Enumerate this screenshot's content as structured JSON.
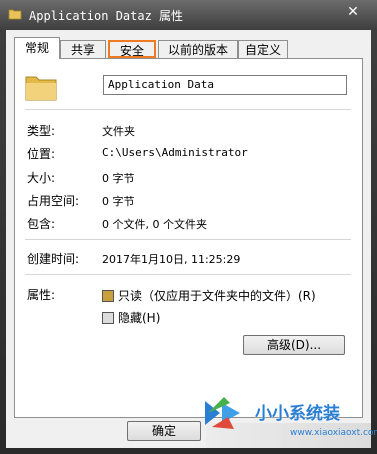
{
  "window": {
    "title": "Application Dataz 属性",
    "close_label": "✕"
  },
  "tabs": [
    {
      "label": "常规"
    },
    {
      "label": "共享"
    },
    {
      "label": "安全"
    },
    {
      "label": "以前的版本"
    },
    {
      "label": "自定义"
    }
  ],
  "general": {
    "name_value": "Application Data",
    "type_label": "类型:",
    "type_value": "文件夹",
    "location_label": "位置:",
    "location_value": "C:\\Users\\Administrator",
    "size_label": "大小:",
    "size_value": "0 字节",
    "disk_label": "占用空间:",
    "disk_value": "0 字节",
    "contains_label": "包含:",
    "contains_value": "0 个文件, 0 个文件夹",
    "created_label": "创建时间:",
    "created_value": "2017年1月10日, 11:25:29",
    "attributes_label": "属性:",
    "readonly_label": "只读（仅应用于文件夹中的文件）(R)",
    "hidden_label": "隐藏(H)",
    "advanced_label": "高级(D)..."
  },
  "buttons": {
    "ok_label": "确定"
  },
  "watermark": {
    "text": "小小系统装",
    "url": "www.xiaoxiaoxt.com"
  },
  "colors": {
    "focus_tab_border": "#f07a22",
    "readonly_checkbox": "#c8a040",
    "watermark": "#2a7fd4"
  }
}
